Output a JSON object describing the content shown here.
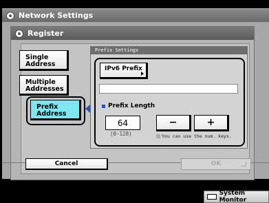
{
  "window": {
    "title": "Network Settings"
  },
  "register": {
    "title": "Register"
  },
  "options": {
    "single": "Single\nAddress",
    "multiple": "Multiple\nAddresses",
    "prefix": "Prefix\nAddress"
  },
  "prefix_settings": {
    "group_title": "Prefix Settings",
    "ipv6_prefix_label": "IPv6 Prefix",
    "ipv6_prefix_value": "",
    "length_label": "Prefix Length",
    "length_value": "64",
    "length_range": "(0-128)",
    "minus_label": "−",
    "plus_label": "+",
    "keys_note": "You can use the num. keys."
  },
  "footer": {
    "cancel_label": "Cancel",
    "ok_label": "OK"
  },
  "status_bar": {
    "system_monitor_label": "System Monitor"
  },
  "colors": {
    "selected": "#7fe6ef",
    "accent": "#2a52be"
  }
}
